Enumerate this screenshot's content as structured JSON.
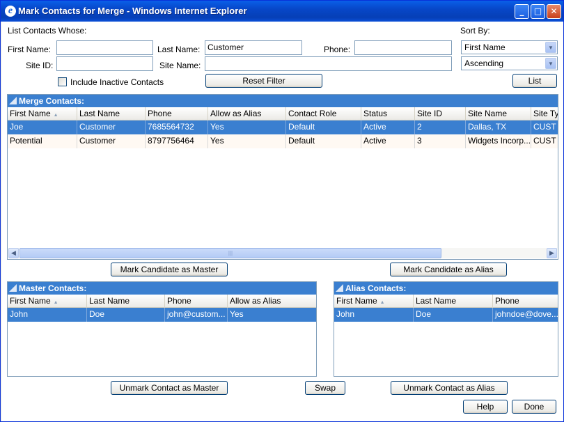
{
  "window": {
    "title": "Mark Contacts for Merge - Windows Internet Explorer",
    "icon_glyph": "e",
    "min_glyph": "_",
    "max_glyph": "□",
    "close_glyph": "✕"
  },
  "filter": {
    "heading": "List Contacts Whose:",
    "first_name_label": "First Name:",
    "first_name_value": "",
    "last_name_label": "Last Name:",
    "last_name_value": "Customer",
    "phone_label": "Phone:",
    "phone_value": "",
    "site_id_label": "Site ID:",
    "site_id_value": "",
    "site_name_label": "Site Name:",
    "site_name_value": "",
    "include_inactive_label": "Include Inactive Contacts",
    "include_inactive_checked": false,
    "reset_filter_label": "Reset Filter"
  },
  "sort": {
    "heading": "Sort By:",
    "field_value": "First Name",
    "order_value": "Ascending",
    "list_label": "List"
  },
  "merge_contacts": {
    "title": "Merge Contacts:",
    "columns": [
      "First Name",
      "Last Name",
      "Phone",
      "Allow as Alias",
      "Contact Role",
      "Status",
      "Site ID",
      "Site Name",
      "Site Type"
    ],
    "rows": [
      [
        "Joe",
        "Customer",
        "7685564732",
        "Yes",
        "Default",
        "Active",
        "2",
        "Dallas, TX",
        "CUST"
      ],
      [
        "Potential",
        "Customer",
        "8797756464",
        "Yes",
        "Default",
        "Active",
        "3",
        "Widgets Incorp...",
        "CUST"
      ]
    ],
    "selected_row": 0,
    "scroll_thumb_glyph": "|||",
    "scroll_left_glyph": "◀",
    "scroll_right_glyph": "▶"
  },
  "actions": {
    "mark_master_label": "Mark Candidate as Master",
    "mark_alias_label": "Mark Candidate as Alias",
    "unmark_master_label": "Unmark Contact as Master",
    "swap_label": "Swap",
    "unmark_alias_label": "Unmark Contact as Alias",
    "help_label": "Help",
    "done_label": "Done"
  },
  "master_contacts": {
    "title": "Master Contacts:",
    "columns": [
      "First Name",
      "Last Name",
      "Phone",
      "Allow as Alias"
    ],
    "rows": [
      [
        "John",
        "Doe",
        "john@custom...",
        "Yes"
      ]
    ],
    "selected_row": 0
  },
  "alias_contacts": {
    "title": "Alias Contacts:",
    "columns": [
      "First Name",
      "Last Name",
      "Phone"
    ],
    "rows": [
      [
        "John",
        "Doe",
        "johndoe@dove..."
      ]
    ],
    "selected_row": 0
  },
  "sort_indicator": "▲",
  "dropdown_arrow": "▼",
  "colors": {
    "selection": "#3a7fd0",
    "titlebar": "#0747c8",
    "panel_header": "#3a7fd0"
  }
}
